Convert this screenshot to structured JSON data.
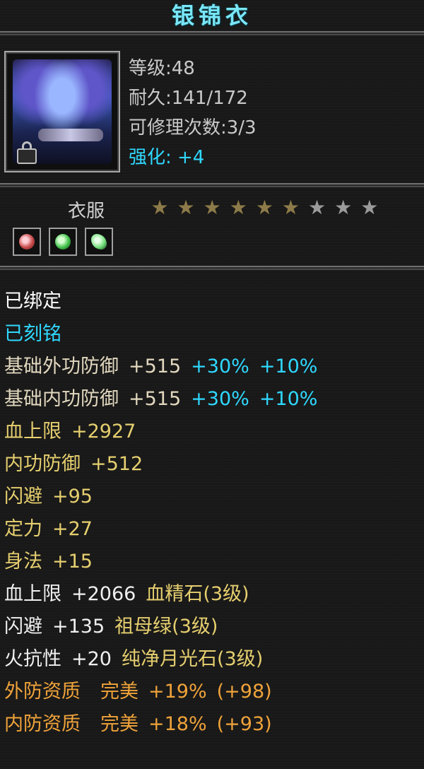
{
  "item": {
    "name": "银锦衣",
    "level": "等级:48",
    "durability": "耐久:141/172",
    "repairs": "可修理次数:3/3",
    "enhance": "强化: +4",
    "category": "衣服",
    "stars": {
      "filled": 6,
      "total": 9
    },
    "gems": [
      "red-gem-icon",
      "green-gem-icon",
      "moonstone-icon"
    ]
  },
  "properties": {
    "bound": "已绑定",
    "engraved": "已刻铭",
    "base_ext_def": {
      "label": "基础外功防御",
      "value": "+515",
      "p1": "+30%",
      "p2": "+10%"
    },
    "base_int_def": {
      "label": "基础内功防御",
      "value": "+515",
      "p1": "+30%",
      "p2": "+10%"
    },
    "hp_cap": {
      "label": "血上限",
      "value": "+2927"
    },
    "int_def": {
      "label": "内功防御",
      "value": "+512"
    },
    "dodge": {
      "label": "闪避",
      "value": "+95"
    },
    "focus": {
      "label": "定力",
      "value": "+27"
    },
    "agility": {
      "label": "身法",
      "value": "+15"
    },
    "hp_gem": {
      "label": "血上限",
      "value": "+2066",
      "gem": "血精石(3级)"
    },
    "dodge_gem": {
      "label": "闪避",
      "value": "+135",
      "gem": "祖母绿(3级)"
    },
    "fire_res_gem": {
      "label": "火抗性",
      "value": "+20",
      "gem": "纯净月光石(3级)"
    },
    "ext_quality": {
      "label": "外防资质",
      "grade": "完美",
      "pct": "+19%",
      "bonus": "(+98)"
    },
    "int_quality": {
      "label": "内防资质",
      "grade": "完美",
      "pct": "+18%",
      "bonus": "(+93)"
    }
  }
}
